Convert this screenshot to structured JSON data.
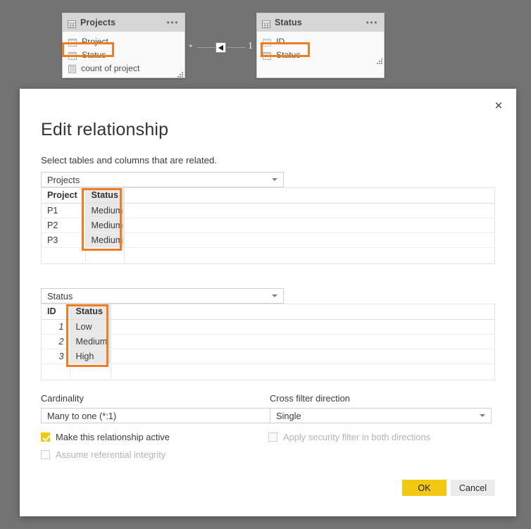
{
  "canvas": {
    "background_color": "#737373",
    "tables": [
      {
        "name": "Projects",
        "icon": "table-icon",
        "menu_icon": "ellipsis-icon",
        "fields": [
          {
            "label": "Project",
            "icon": "column-icon",
            "highlighted": false
          },
          {
            "label": "Status",
            "icon": "column-icon",
            "highlighted": true
          },
          {
            "label": "count of project",
            "icon": "measure-calculator-icon",
            "highlighted": false
          }
        ]
      },
      {
        "name": "Status",
        "icon": "table-icon",
        "menu_icon": "ellipsis-icon",
        "fields": [
          {
            "label": "ID",
            "icon": "column-icon",
            "highlighted": false
          },
          {
            "label": "Status",
            "icon": "column-icon",
            "highlighted": true
          }
        ]
      }
    ],
    "relationship": {
      "left_cardinality": "*",
      "right_cardinality": "1",
      "filter_direction_icon": "left-arrow-icon"
    }
  },
  "dialog": {
    "title": "Edit relationship",
    "subtitle": "Select tables and columns that are related.",
    "close_label": "✕",
    "from": {
      "table_select": {
        "value": "Projects",
        "caret_icon": "chevron-down-icon"
      },
      "preview": {
        "columns": [
          "Project",
          "Status"
        ],
        "selected_column": "Status",
        "numeric_columns": [],
        "rows": [
          [
            "P1",
            "Medium"
          ],
          [
            "P2",
            "Medium"
          ],
          [
            "P3",
            "Medium"
          ]
        ]
      }
    },
    "to": {
      "table_select": {
        "value": "Status",
        "caret_icon": "chevron-down-icon"
      },
      "preview": {
        "columns": [
          "ID",
          "Status"
        ],
        "selected_column": "Status",
        "numeric_columns": [
          "ID"
        ],
        "rows": [
          [
            "1",
            "Low"
          ],
          [
            "2",
            "Medium"
          ],
          [
            "3",
            "High"
          ]
        ]
      }
    },
    "cardinality": {
      "label": "Cardinality",
      "value": "Many to one (*:1)",
      "caret_icon": "chevron-down-icon"
    },
    "cross_filter": {
      "label": "Cross filter direction",
      "value": "Single",
      "caret_icon": "chevron-down-icon"
    },
    "checkboxes": {
      "active": {
        "label": "Make this relationship active",
        "checked": true,
        "disabled": false
      },
      "referential": {
        "label": "Assume referential integrity",
        "checked": false,
        "disabled": true
      },
      "security": {
        "label": "Apply security filter in both directions",
        "checked": false,
        "disabled": true
      }
    },
    "buttons": {
      "ok": "OK",
      "cancel": "Cancel"
    },
    "accent_colors": {
      "primary": "#f2c811",
      "highlight": "#ef7d22",
      "selected_cell": "#e8e8e8"
    }
  }
}
